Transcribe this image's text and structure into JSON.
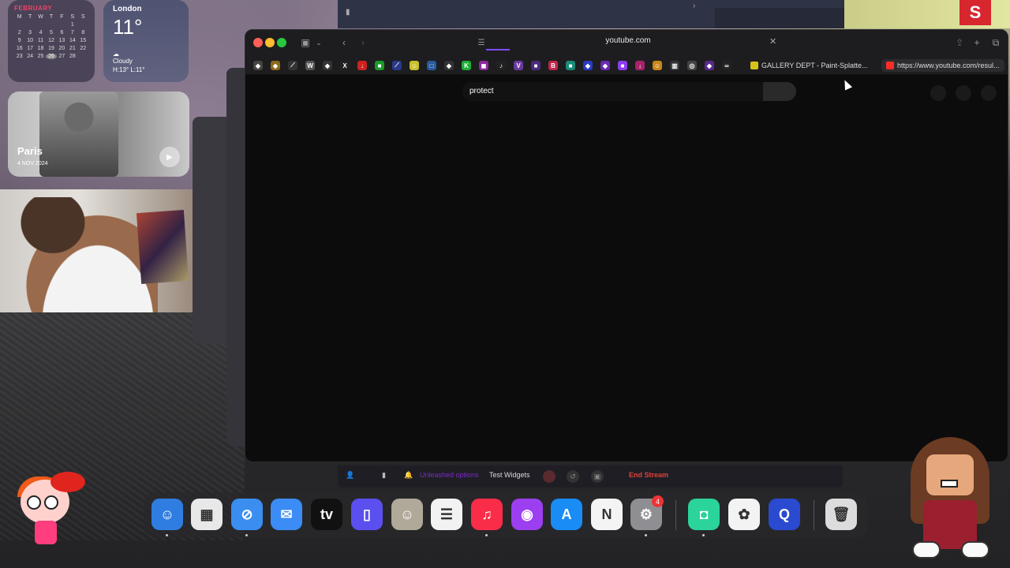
{
  "calendar": {
    "month": "FEBRUARY",
    "weekdays": [
      "M",
      "T",
      "W",
      "T",
      "F",
      "S",
      "S"
    ],
    "days": [
      "",
      "",
      "",
      "",
      "",
      "1",
      "",
      "2",
      "3",
      "4",
      "5",
      "6",
      "7",
      "8",
      "9",
      "10",
      "11",
      "12",
      "13",
      "14",
      "15",
      "16",
      "17",
      "18",
      "19",
      "20",
      "21",
      "22",
      "23",
      "24",
      "25",
      "26",
      "27",
      "28",
      ""
    ],
    "today": "26"
  },
  "weather": {
    "city": "London",
    "temp": "11°",
    "condition": "Cloudy",
    "range": "H:13° L:11°"
  },
  "photo_widget": {
    "title": "Paris",
    "date": "4 NOV 2024"
  },
  "browser": {
    "url_host": "youtube.com",
    "search_query": "protect",
    "favorites_tabs": [
      {
        "label": "GALLERY DEPT - Paint-Splatte...",
        "color": "#d9c21a"
      },
      {
        "label": "https://www.youtube.com/resul...",
        "color": "#ff2a2a"
      }
    ],
    "favicons": [
      {
        "name": "diamond-fav",
        "color": "#444",
        "glyph": "◆"
      },
      {
        "name": "lamp-fav",
        "color": "#8a6a1a",
        "glyph": "◆"
      },
      {
        "name": "slash-fav",
        "color": "#333",
        "glyph": "⟋"
      },
      {
        "name": "w-fav",
        "color": "#555",
        "glyph": "W"
      },
      {
        "name": "diamond2-fav",
        "color": "#333",
        "glyph": "◆"
      },
      {
        "name": "x-fav",
        "color": "#222",
        "glyph": "X"
      },
      {
        "name": "download-fav",
        "color": "#c22",
        "glyph": "↓"
      },
      {
        "name": "green-fav",
        "color": "#1a9a2a",
        "glyph": "■"
      },
      {
        "name": "pen-fav",
        "color": "#2a3a8a",
        "glyph": "⟋"
      },
      {
        "name": "smile-fav",
        "color": "#c9c12a",
        "glyph": "☺"
      },
      {
        "name": "chat-fav",
        "color": "#2a5a9a",
        "glyph": "□"
      },
      {
        "name": "diamond3-fav",
        "color": "#333",
        "glyph": "◆"
      },
      {
        "name": "kick-fav",
        "color": "#1fae3a",
        "glyph": "K"
      },
      {
        "name": "pink-fav",
        "color": "#8a2a9a",
        "glyph": "◼"
      },
      {
        "name": "tiktok-fav",
        "color": "#222",
        "glyph": "♪"
      },
      {
        "name": "v-fav",
        "color": "#6a3aa0",
        "glyph": "V"
      },
      {
        "name": "purple-fav",
        "color": "#4a2a7a",
        "glyph": "■"
      },
      {
        "name": "b-fav",
        "color": "#c2264a",
        "glyph": "B"
      },
      {
        "name": "teal-fav",
        "color": "#1a8a7a",
        "glyph": "■"
      },
      {
        "name": "blue-fav",
        "color": "#2a3ac0",
        "glyph": "◆"
      },
      {
        "name": "violet-fav",
        "color": "#6a2ab0",
        "glyph": "◆"
      },
      {
        "name": "twitch-fav",
        "color": "#8b3cf2",
        "glyph": "■"
      },
      {
        "name": "arrow-fav",
        "color": "#a8226a",
        "glyph": "↓"
      },
      {
        "name": "gold-fav",
        "color": "#c9871a",
        "glyph": "☺"
      },
      {
        "name": "grid-fav",
        "color": "#333",
        "glyph": "▥"
      },
      {
        "name": "white-fav",
        "color": "#444",
        "glyph": "◎"
      },
      {
        "name": "alpha-fav",
        "color": "#5a2a8a",
        "glyph": "◆"
      },
      {
        "name": "eyes-fav",
        "color": "#222",
        "glyph": "∞"
      }
    ]
  },
  "streambar": {
    "purple_label": "Unleashed options",
    "test_label": "Test Widgets",
    "end_label": "End Stream"
  },
  "dock": {
    "apps": [
      {
        "name": "finder",
        "color": "#2f7de1",
        "glyph": "☺"
      },
      {
        "name": "launchpad",
        "color": "#e8e8e8",
        "glyph": "▦"
      },
      {
        "name": "safari",
        "color": "#3a8ef0",
        "glyph": "⊘"
      },
      {
        "name": "mail",
        "color": "#3b8cf5",
        "glyph": "✉"
      },
      {
        "name": "appletv",
        "color": "#111",
        "glyph": "tv"
      },
      {
        "name": "simulator",
        "color": "#5b4ff0",
        "glyph": "▯"
      },
      {
        "name": "contacts",
        "color": "#b0a898",
        "glyph": "☺"
      },
      {
        "name": "reminders",
        "color": "#f2f2f2",
        "glyph": "☰"
      },
      {
        "name": "music",
        "color": "#fa2d48",
        "glyph": "♫"
      },
      {
        "name": "podcasts",
        "color": "#9b3ff0",
        "glyph": "◉"
      },
      {
        "name": "appstore",
        "color": "#1a8cf5",
        "glyph": "A"
      },
      {
        "name": "news",
        "color": "#f4f4f4",
        "glyph": "N"
      },
      {
        "name": "settings",
        "color": "#8e8e93",
        "glyph": "⚙"
      },
      {
        "name": "streamlabs",
        "color": "#2ad49a",
        "glyph": "◘"
      },
      {
        "name": "photos",
        "color": "#f3f3f3",
        "glyph": "✿"
      },
      {
        "name": "quicktime",
        "color": "#2a4ad0",
        "glyph": "Q"
      },
      {
        "name": "trash",
        "color": "#dcdcdc",
        "glyph": "🗑"
      }
    ],
    "settings_badge": "4"
  },
  "s_badge": "S",
  "colors": {
    "accent": "#7c4dff",
    "end_stream": "#e0403a"
  }
}
